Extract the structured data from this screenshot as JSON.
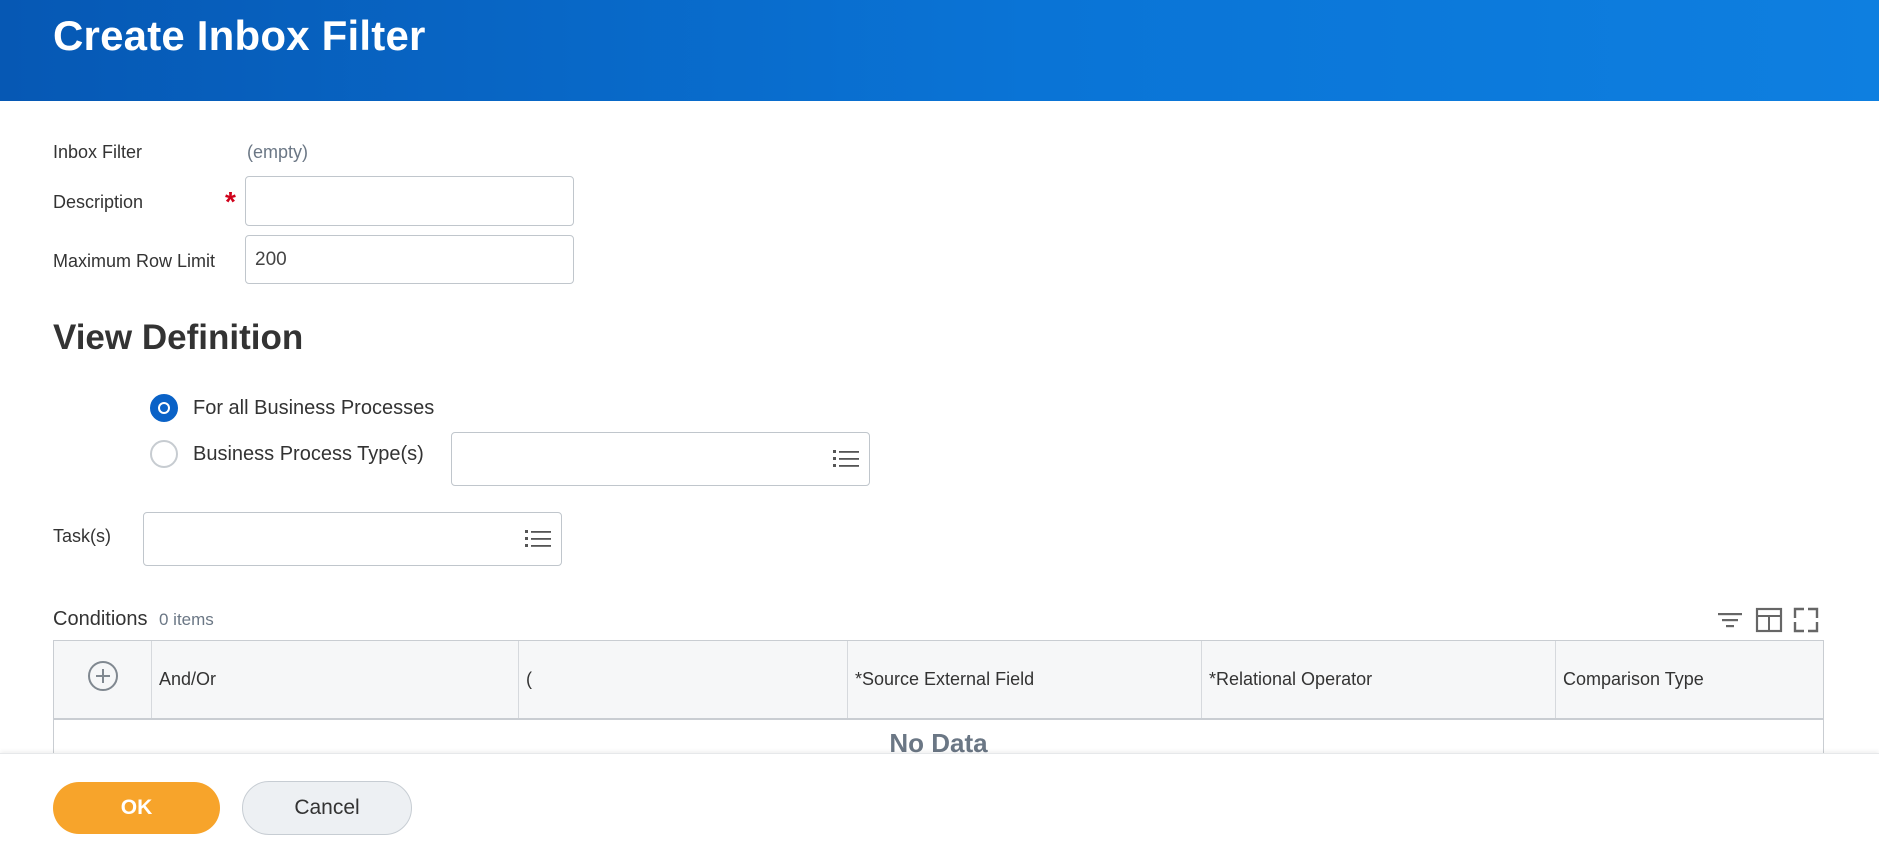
{
  "header": {
    "title": "Create Inbox Filter"
  },
  "form": {
    "inbox_filter": {
      "label": "Inbox Filter",
      "value": "(empty)"
    },
    "description": {
      "label": "Description",
      "required_marker": "*",
      "value": ""
    },
    "max_row_limit": {
      "label": "Maximum Row Limit",
      "value": "200"
    }
  },
  "view_definition": {
    "title": "View Definition",
    "options": [
      {
        "label": "For all Business Processes",
        "selected": true
      },
      {
        "label": "Business Process Type(s)",
        "selected": false
      }
    ],
    "tasks_label": "Task(s)"
  },
  "conditions": {
    "title": "Conditions",
    "count": "0 items",
    "columns": [
      "And/Or",
      "(",
      "*Source External Field",
      "*Relational Operator",
      "Comparison Type"
    ],
    "empty_text": "No Data"
  },
  "footer": {
    "ok_label": "OK",
    "cancel_label": "Cancel"
  },
  "colors": {
    "header": "#0a6ad0",
    "ok": "#f7a42b",
    "radio_selected": "#0a62c7",
    "required": "#d0021b"
  },
  "icons": [
    "list-icon",
    "filter-icon",
    "column-layout-icon",
    "fullscreen-icon",
    "add-row-icon"
  ]
}
